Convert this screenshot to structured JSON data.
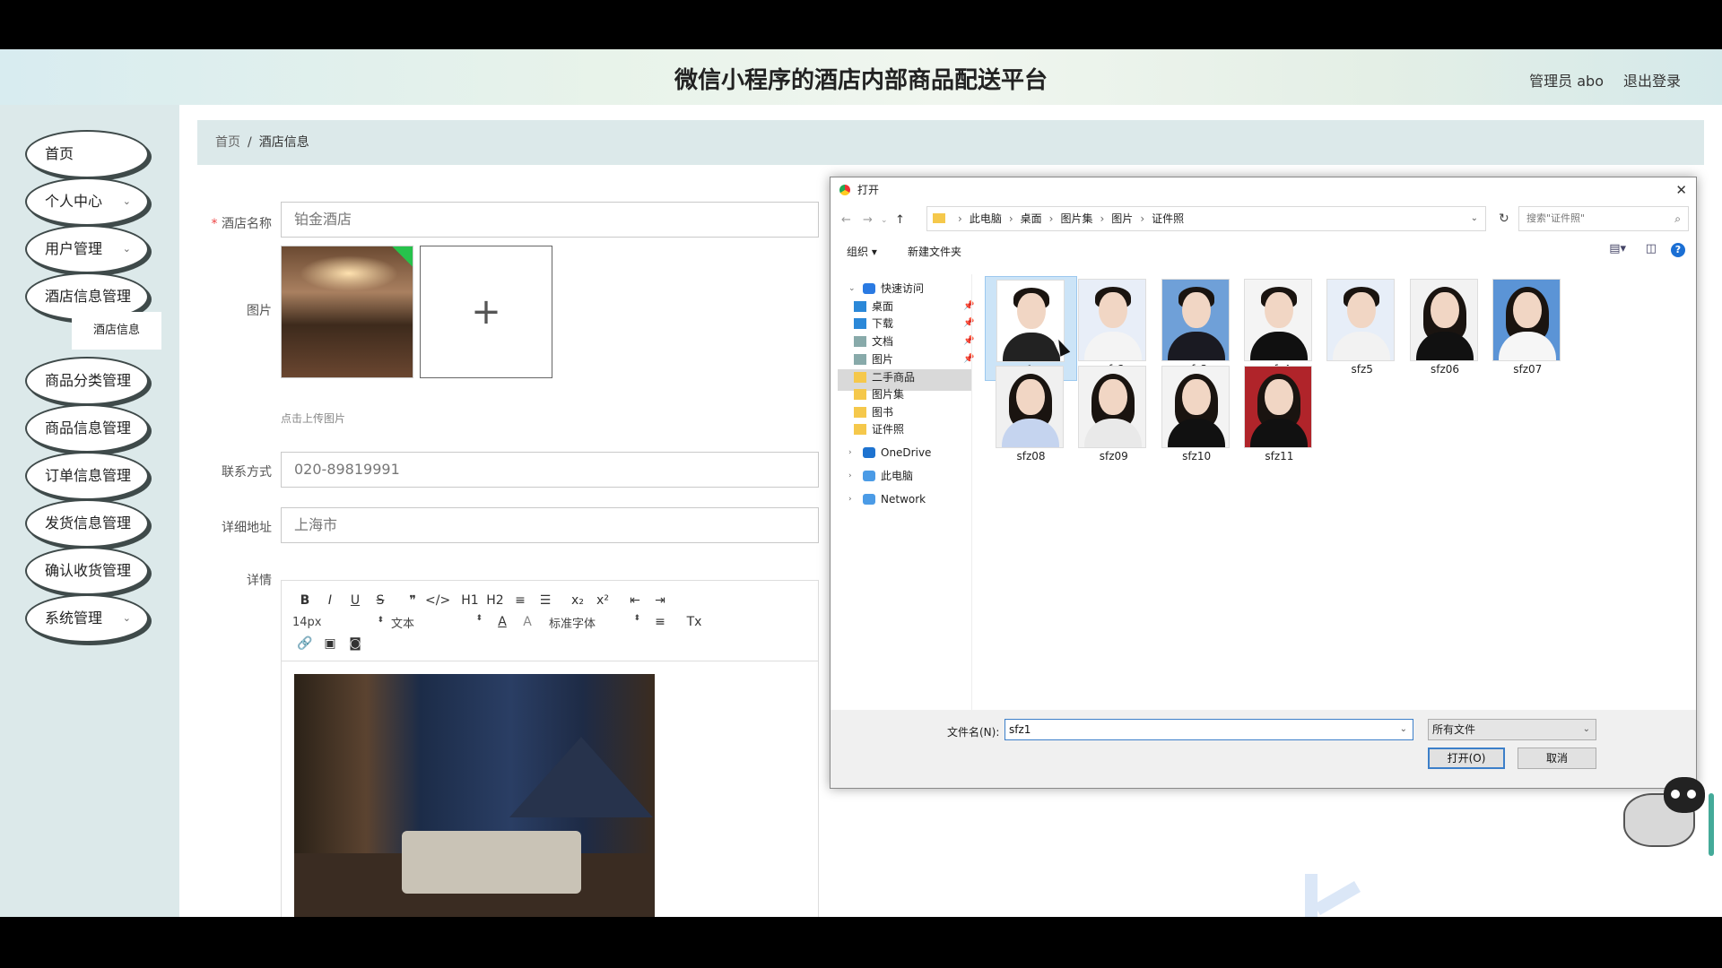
{
  "header": {
    "title": "微信小程序的酒店内部商品配送平台",
    "user": "管理员 abo",
    "logout": "退出登录"
  },
  "sidebar": {
    "items": [
      {
        "label": "首页",
        "expandable": false
      },
      {
        "label": "个人中心",
        "expandable": true
      },
      {
        "label": "用户管理",
        "expandable": true
      },
      {
        "label": "酒店信息管理",
        "expandable": false
      },
      {
        "label": "商品分类管理",
        "expandable": false
      },
      {
        "label": "商品信息管理",
        "expandable": false
      },
      {
        "label": "订单信息管理",
        "expandable": false
      },
      {
        "label": "发货信息管理",
        "expandable": false
      },
      {
        "label": "确认收货管理",
        "expandable": false
      },
      {
        "label": "系统管理",
        "expandable": true
      }
    ],
    "submenu": {
      "label": "酒店信息"
    }
  },
  "breadcrumb": {
    "home": "首页",
    "separator": "/",
    "current": "酒店信息"
  },
  "form": {
    "hotel_name": {
      "label": "酒店名称",
      "required_mark": "*",
      "value": "铂金酒店"
    },
    "image": {
      "label": "图片",
      "upload_hint": "点击上传图片",
      "upload_plus": "+"
    },
    "contact": {
      "label": "联系方式",
      "value": "020-89819991"
    },
    "address": {
      "label": "详细地址",
      "value": "上海市"
    },
    "detail": {
      "label": "详情"
    }
  },
  "editor": {
    "row1": [
      "B",
      "I",
      "U",
      "S",
      "❞",
      "</>",
      "H1",
      "H2",
      "≡",
      "☰",
      "x₂",
      "x²",
      "⇤",
      "⇥"
    ],
    "font_size": "14px",
    "text_style": "文本",
    "font_color": "A",
    "bg_color": "A",
    "font_family": "标准字体",
    "align": "≡",
    "clear": "Tx",
    "row3_icons": [
      "link-icon",
      "image-icon",
      "video-icon"
    ]
  },
  "dialog": {
    "title": "打开",
    "path": [
      "此电脑",
      "桌面",
      "图片集",
      "图片",
      "证件照"
    ],
    "search_placeholder": "搜索\"证件照\"",
    "toolbar": {
      "organize": "组织 ▾",
      "new_folder": "新建文件夹",
      "help": "?"
    },
    "tree": [
      {
        "label": "快速访问",
        "level": 0
      },
      {
        "label": "桌面",
        "level": 1,
        "pinned": true
      },
      {
        "label": "下载",
        "level": 1,
        "pinned": true
      },
      {
        "label": "文档",
        "level": 1,
        "pinned": true
      },
      {
        "label": "图片",
        "level": 1,
        "pinned": true
      },
      {
        "label": "二手商品",
        "level": 1
      },
      {
        "label": "图片集",
        "level": 1
      },
      {
        "label": "图书",
        "level": 1
      },
      {
        "label": "证件照",
        "level": 1
      },
      {
        "label": "OneDrive",
        "level": 0
      },
      {
        "label": "此电脑",
        "level": 0,
        "selected": true
      },
      {
        "label": "Network",
        "level": 0
      }
    ],
    "files": [
      {
        "name": "sfz1",
        "selected": true,
        "gender": "m"
      },
      {
        "name": "sfz2",
        "gender": "m"
      },
      {
        "name": "sfz3",
        "gender": "m"
      },
      {
        "name": "sfz4",
        "gender": "m"
      },
      {
        "name": "sfz5",
        "gender": "m"
      },
      {
        "name": "sfz06",
        "gender": "f"
      },
      {
        "name": "sfz07",
        "gender": "f"
      },
      {
        "name": "sfz08",
        "gender": "f"
      },
      {
        "name": "sfz09",
        "gender": "f"
      },
      {
        "name": "sfz10",
        "gender": "f"
      },
      {
        "name": "sfz11",
        "gender": "f"
      }
    ],
    "filename_label": "文件名(N):",
    "filename_value": "sfz1",
    "filetype": "所有文件",
    "open_button": "打开(O)",
    "cancel_button": "取消"
  },
  "colors": {
    "sidebar_bg": "#dce9ea",
    "menu_border": "#3f4a4a",
    "accent_blue": "#3c7fc9",
    "selection": "#cce4f7"
  }
}
